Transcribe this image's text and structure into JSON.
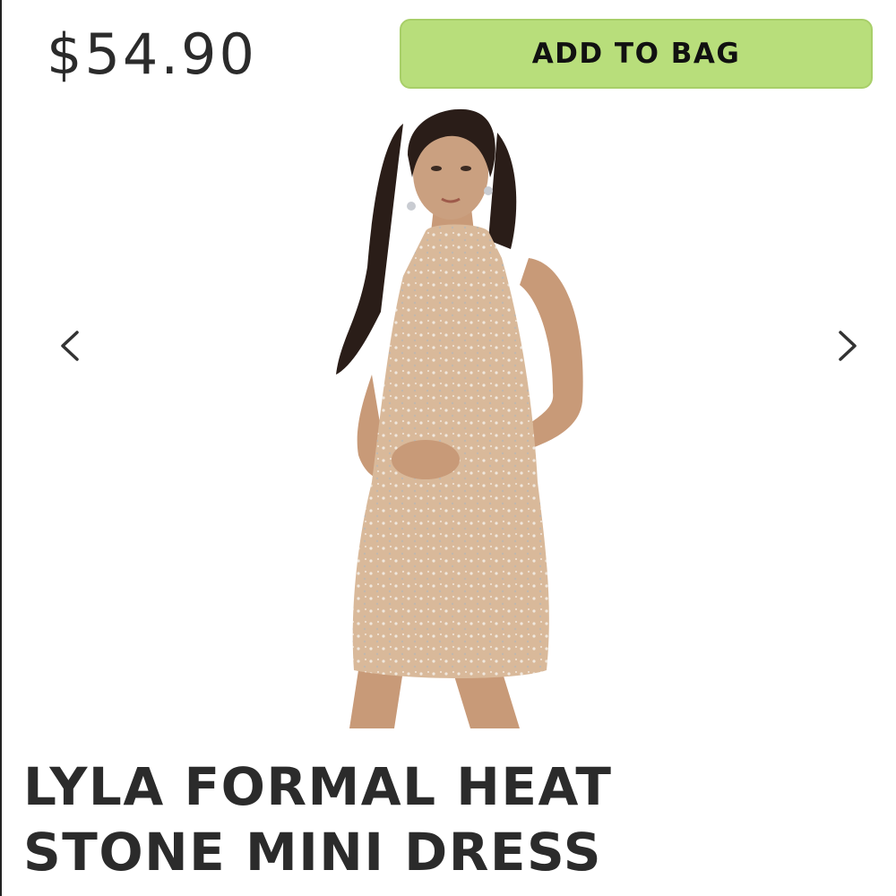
{
  "product": {
    "price": "$54.90",
    "add_to_bag_label": "ADD TO BAG",
    "title_line1": "LYLA FORMAL HEAT",
    "title_line2": "STONE MINI DRESS"
  },
  "gallery": {
    "prev_icon": "chevron-left-icon",
    "next_icon": "chevron-right-icon"
  },
  "colors": {
    "button_bg": "#b8de7b",
    "text": "#2b2b2b",
    "dress": "#d9b99a"
  }
}
